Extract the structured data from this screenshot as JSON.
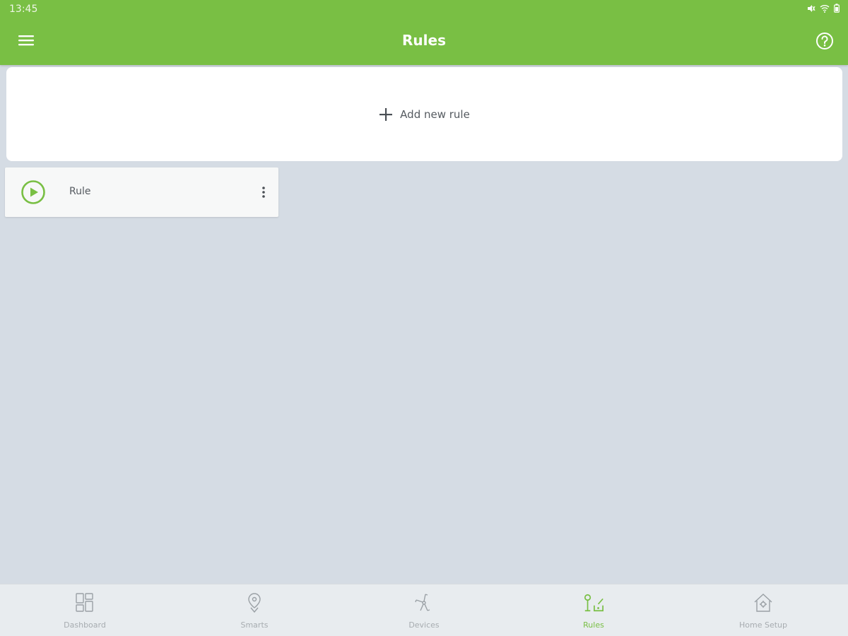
{
  "status": {
    "time": "13:45"
  },
  "header": {
    "title": "Rules"
  },
  "add_rule": {
    "label": "Add new rule"
  },
  "rules": [
    {
      "name": "Rule"
    }
  ],
  "nav": {
    "items": [
      {
        "label": "Dashboard",
        "icon": "dashboard-icon"
      },
      {
        "label": "Smarts",
        "icon": "smarts-icon"
      },
      {
        "label": "Devices",
        "icon": "devices-icon"
      },
      {
        "label": "Rules",
        "icon": "rules-icon",
        "active": true
      },
      {
        "label": "Home Setup",
        "icon": "home-setup-icon"
      }
    ]
  },
  "colors": {
    "accent": "#79bf44",
    "background": "#d5dce4",
    "nav_inactive": "#a7acb0"
  }
}
